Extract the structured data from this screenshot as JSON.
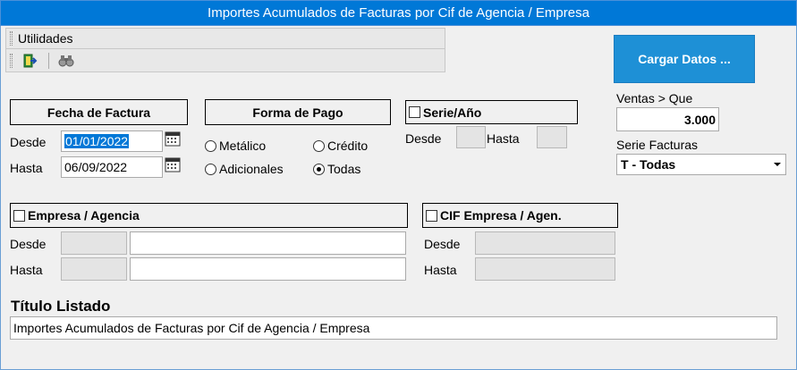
{
  "window": {
    "title": "Importes Acumulados de Facturas por Cif de Agencia / Empresa"
  },
  "menu": {
    "utilidades": "Utilidades"
  },
  "toolbar": {
    "exit_icon": "exit-door-icon",
    "find_icon": "binoculars-icon"
  },
  "cargar": {
    "label": "Cargar Datos ..."
  },
  "fecha": {
    "title": "Fecha de Factura",
    "desde_label": "Desde",
    "desde_value": "01/01/2022",
    "hasta_label": "Hasta",
    "hasta_value": "06/09/2022"
  },
  "forma_pago": {
    "title": "Forma de Pago",
    "options": [
      {
        "label": "Metálico",
        "checked": false
      },
      {
        "label": "Crédito",
        "checked": false
      },
      {
        "label": "Adicionales",
        "checked": false
      },
      {
        "label": "Todas",
        "checked": true
      }
    ]
  },
  "serie_anio": {
    "title": "Serie/Año",
    "desde_label": "Desde",
    "hasta_label": "Hasta"
  },
  "ventas": {
    "label": "Ventas > Que",
    "value": "3.000"
  },
  "serie_facturas": {
    "label": "Serie Facturas",
    "selected": "T - Todas"
  },
  "empresa": {
    "title": "Empresa / Agencia",
    "desde_label": "Desde",
    "hasta_label": "Hasta"
  },
  "cif": {
    "title": "CIF Empresa / Agen.",
    "desde_label": "Desde",
    "hasta_label": "Hasta"
  },
  "titulo": {
    "label": "Título Listado",
    "value": "Importes Acumulados de Facturas por Cif de Agencia / Empresa"
  },
  "colors": {
    "titlebar": "#0078d7",
    "cargar_button": "#1e90d6",
    "selection": "#0078d7"
  }
}
